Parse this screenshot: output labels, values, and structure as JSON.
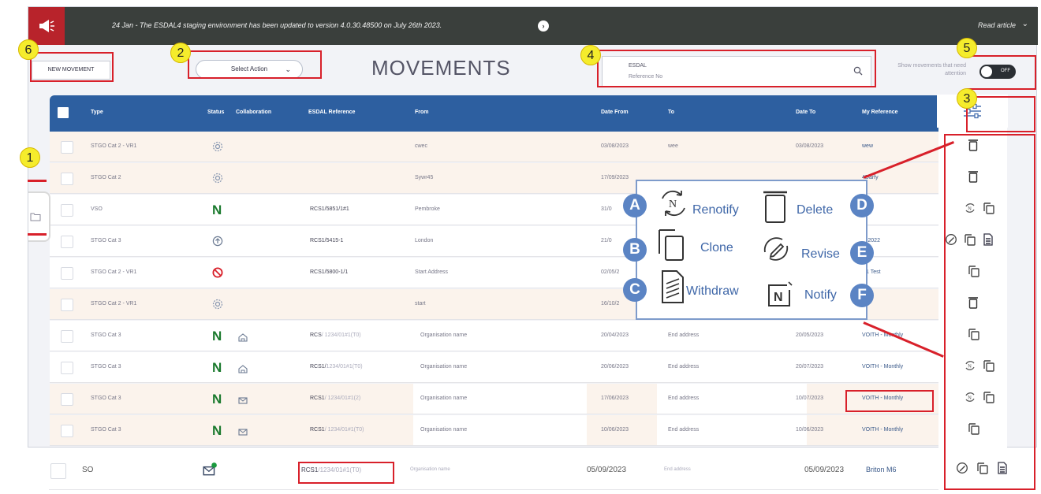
{
  "banner": {
    "message": "24 Jan - The ESDAL4 staging environment has been updated to version 4.0.30.48500 on July 26th 2023.",
    "read_article": "Read article"
  },
  "toolbar": {
    "new_movement": "NEW MOVEMENT",
    "select_action": "Select Action",
    "page_title": "MOVEMENTS",
    "search_line1": "ESDAL",
    "search_line2": "Reference No",
    "attention_label": "Show movements that need attention",
    "toggle_state": "OFF"
  },
  "table": {
    "headers": {
      "type": "Type",
      "status": "Status",
      "collaboration": "Collaboration",
      "esdal_ref": "ESDAL Reference",
      "from": "From",
      "date_from": "Date From",
      "to": "To",
      "date_to": "Date To",
      "my_reference": "My Reference"
    },
    "rows": [
      {
        "type": "STGO Cat 2 - VR1",
        "status": "draft",
        "from": "cwec",
        "date_from": "03/08/2023",
        "to": "wee",
        "date_to": "03/08/2023",
        "my_ref": "wew",
        "esdal_ref": "",
        "esdal_ref_suffix": "",
        "bg": "peach",
        "actions": [
          "delete"
        ]
      },
      {
        "type": "STGO Cat 2",
        "status": "draft",
        "from": "Sywr45",
        "date_from": "17/09/2023",
        "to": "",
        "date_to": "",
        "my_ref": "4Darfy",
        "esdal_ref": "",
        "esdal_ref_suffix": "",
        "bg": "peach",
        "actions": [
          "delete"
        ]
      },
      {
        "type": "VSO",
        "status": "N",
        "from": "Pembroke",
        "date_from": "31/0",
        "to": "",
        "date_to": "",
        "my_ref": "",
        "esdal_ref": "RCS1/5851/1#1",
        "esdal_ref_suffix": "",
        "bg": "white",
        "actions": [
          "renotify",
          "clone"
        ]
      },
      {
        "type": "STGO Cat 3",
        "status": "up",
        "from": "London",
        "date_from": "21/0",
        "to": "",
        "date_to": "",
        "my_ref": "y02022",
        "esdal_ref": "RCS1/5415-1",
        "esdal_ref_suffix": "",
        "bg": "white",
        "actions": [
          "revise",
          "clone",
          "withdraw"
        ]
      },
      {
        "type": "STGO Cat 2 - VR1",
        "status": "stop",
        "from": "Start Address",
        "date_from": "02/05/2",
        "to": "",
        "date_to": "",
        "my_ref": "R1 Test",
        "esdal_ref": "RCS1/5800-1/1",
        "esdal_ref_suffix": "",
        "bg": "white",
        "actions": [
          "clone"
        ]
      },
      {
        "type": "STGO Cat 2 - VR1",
        "status": "draft",
        "from": "start",
        "date_from": "16/10/2",
        "to": "",
        "date_to": "",
        "my_ref": "",
        "esdal_ref": "",
        "esdal_ref_suffix": "",
        "bg": "peach",
        "actions": [
          "delete"
        ]
      },
      {
        "type": "STGO Cat 3",
        "status": "N",
        "collab": "home",
        "from": "Organisation name",
        "date_from": "20/04/2023",
        "to": "End address",
        "date_to": "20/05/2023",
        "my_ref": "VOITH - Monthly",
        "esdal_ref": "RCS",
        "esdal_ref_suffix": "/ 1234/01#1(T0)",
        "bg": "white",
        "actions": [
          "clone"
        ]
      },
      {
        "type": "STGO Cat 3",
        "status": "N",
        "collab": "home",
        "from": "Organisation name",
        "date_from": "20/06/2023",
        "to": "End address",
        "date_to": "20/07/2023",
        "my_ref": "VOITH - Monthly",
        "esdal_ref": "RCS1/",
        "esdal_ref_suffix": "1234/01#1(T0)",
        "bg": "white",
        "actions": [
          "renotify",
          "clone"
        ]
      },
      {
        "type": "STGO Cat 3",
        "status": "N",
        "collab": "mail",
        "from": "Organisation name",
        "date_from": "17/06/2023",
        "to": "End address",
        "date_to": "10/07/2023",
        "my_ref": "VOITH - Monthly",
        "esdal_ref": "RCS1",
        "esdal_ref_suffix": "/ 1234/01#1(2)",
        "bg": "peach",
        "actions": [
          "renotify",
          "clone"
        ]
      },
      {
        "type": "STGO Cat 3",
        "status": "N",
        "collab": "mail",
        "from": "Organisation name",
        "date_from": "10/06/2023",
        "to": "End address",
        "date_to": "10/06/2023",
        "my_ref": "VOITH - Monthly",
        "esdal_ref": "RCS1",
        "esdal_ref_suffix": "/ 1234/01#1(T0)",
        "bg": "peach",
        "actions": [
          "clone"
        ]
      }
    ],
    "last_row": {
      "type": "SO",
      "status": "mail-new",
      "esdal_ref": "RCS1",
      "esdal_ref_suffix": "/1234/01#1(T0)",
      "from": "Organisation name",
      "date_from": "05/09/2023",
      "to": "End address",
      "date_to": "05/09/2023",
      "my_ref": "Briton M6"
    }
  },
  "legend": {
    "A": "Renotify",
    "B": "Clone",
    "C": "Withdraw",
    "D": "Delete",
    "E": "Revise",
    "F": "Notify",
    "letters": [
      "A",
      "B",
      "C",
      "D",
      "E",
      "F"
    ]
  },
  "markers": [
    "1",
    "2",
    "3",
    "4",
    "5",
    "6"
  ],
  "colors": {
    "header_blue": "#2d5fa0",
    "brand_red": "#b8232b",
    "status_green": "#1b7a2e",
    "marker_yellow": "#f5ec2c",
    "annotation_red": "#d8202a",
    "legend_blue": "#3f67a8"
  }
}
